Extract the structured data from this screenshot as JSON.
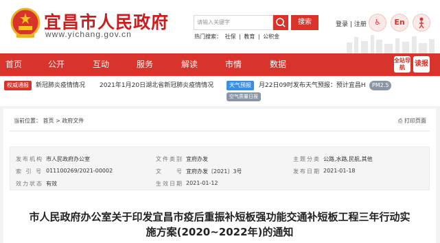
{
  "header": {
    "site_title": "宜昌市人民政府",
    "site_url": "www.yichang.gov.cn",
    "search_placeholder": "请输入关键字",
    "search_button": "搜索",
    "hot_label": "热门搜索：",
    "hot_items": [
      "社保",
      "|",
      "教育",
      "|",
      "公积金"
    ],
    "login": "登录",
    "sep": "|",
    "register": "注册",
    "lang_en": "En",
    "care_label": "长者"
  },
  "nav": {
    "items": [
      "首页",
      "公开",
      "互动",
      "服务",
      "解读",
      "市情",
      "数据"
    ],
    "badge_guide": "全站导航",
    "badge_read": "读报"
  },
  "ticker": {
    "tag": "权威通报",
    "left_text": "新冠肺炎疫情情况",
    "middle_text": "2021年1月20日湖北省新冠肺炎疫情情况",
    "weather_tag": "天气预报",
    "weather_text": "月22日09时发布天气预报：预计宜昌H",
    "pm": "PM2.5",
    "aqi": "空气质量日报"
  },
  "breadcrumb": {
    "label": "当前位置：",
    "home": "首页",
    "arrow": ">",
    "section": "政府文件"
  },
  "print": "打印页面",
  "meta": {
    "publisher_label": "发布机构",
    "publisher": "市人民政府办公室",
    "category_label": "文件类别",
    "category": "宜府办发",
    "subject_label": "主题分类",
    "subject": "公路,水路,民航,其他",
    "index_label": "索 引 号",
    "index": "011100269/2021-00002",
    "docno_label": "文　　号",
    "docno": "宜府办发〔2021〕3号",
    "pubdate_label": "发布日期",
    "pubdate": "2021-01-18",
    "status_label": "效力状态",
    "status": "有效",
    "effdate_label": "生效日期",
    "effdate": "2021-01-12"
  },
  "doc": {
    "title_line1": "市人民政府办公室关于印发宜昌市疫后重振补短板强功能交通补短板工程三年行动实",
    "title_line2": "施方案(2020~2022年)的通知"
  },
  "colors": {
    "brand_red": "#d9342b",
    "weather_blue": "#3a8ee6"
  }
}
